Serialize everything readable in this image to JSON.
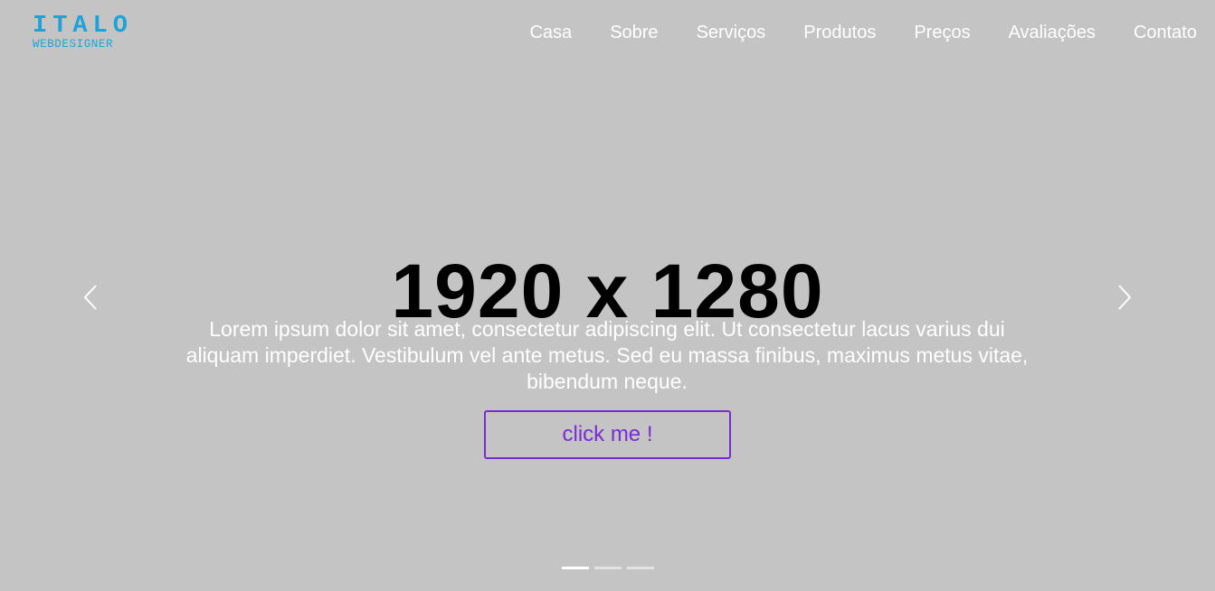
{
  "brand": {
    "name": "ITALO",
    "tagline": "WEBDESIGNER",
    "color": "#1ea3d8"
  },
  "nav": {
    "items": [
      {
        "label": "Casa"
      },
      {
        "label": "Sobre"
      },
      {
        "label": "Serviços"
      },
      {
        "label": "Produtos"
      },
      {
        "label": "Preços"
      },
      {
        "label": "Avaliações"
      },
      {
        "label": "Contato"
      }
    ]
  },
  "carousel": {
    "title": "1920 x 1280",
    "text": "Lorem ipsum dolor sit amet, consectetur adipiscing elit. Ut consectetur lacus varius dui aliquam imperdiet. Vestibulum vel ante metus. Sed eu massa finibus, maximus metus vitae, bibendum neque.",
    "button_label": "click me !",
    "prev_icon": "chevron-left-icon",
    "next_icon": "chevron-right-icon",
    "slide_count": 3,
    "active_slide": 1,
    "background_color": "#c4c4c4",
    "accent_color": "#7b2bd6"
  }
}
